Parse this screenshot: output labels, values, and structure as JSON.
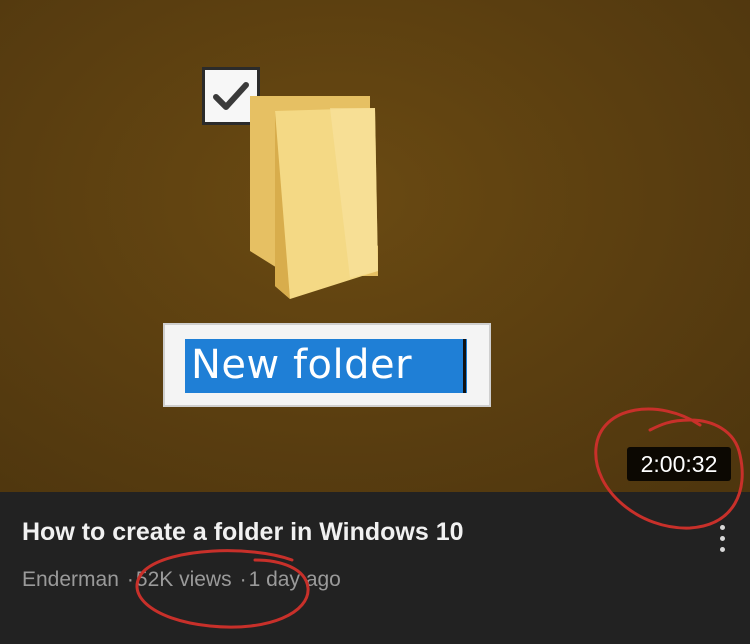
{
  "thumbnail": {
    "folder_name": "New folder",
    "duration": "2:00:32",
    "checkbox_icon": "checkmark-icon",
    "folder_icon": "folder-icon"
  },
  "video": {
    "title": "How to create a folder in Windows 10",
    "channel": "Enderman",
    "views": "52K views",
    "age": "1 day ago",
    "separator": "·"
  },
  "colors": {
    "thumbnail_bg": "#5a3e10",
    "selection": "#1f7fd6",
    "annotation": "#c8302a",
    "info_bg": "#222222"
  }
}
